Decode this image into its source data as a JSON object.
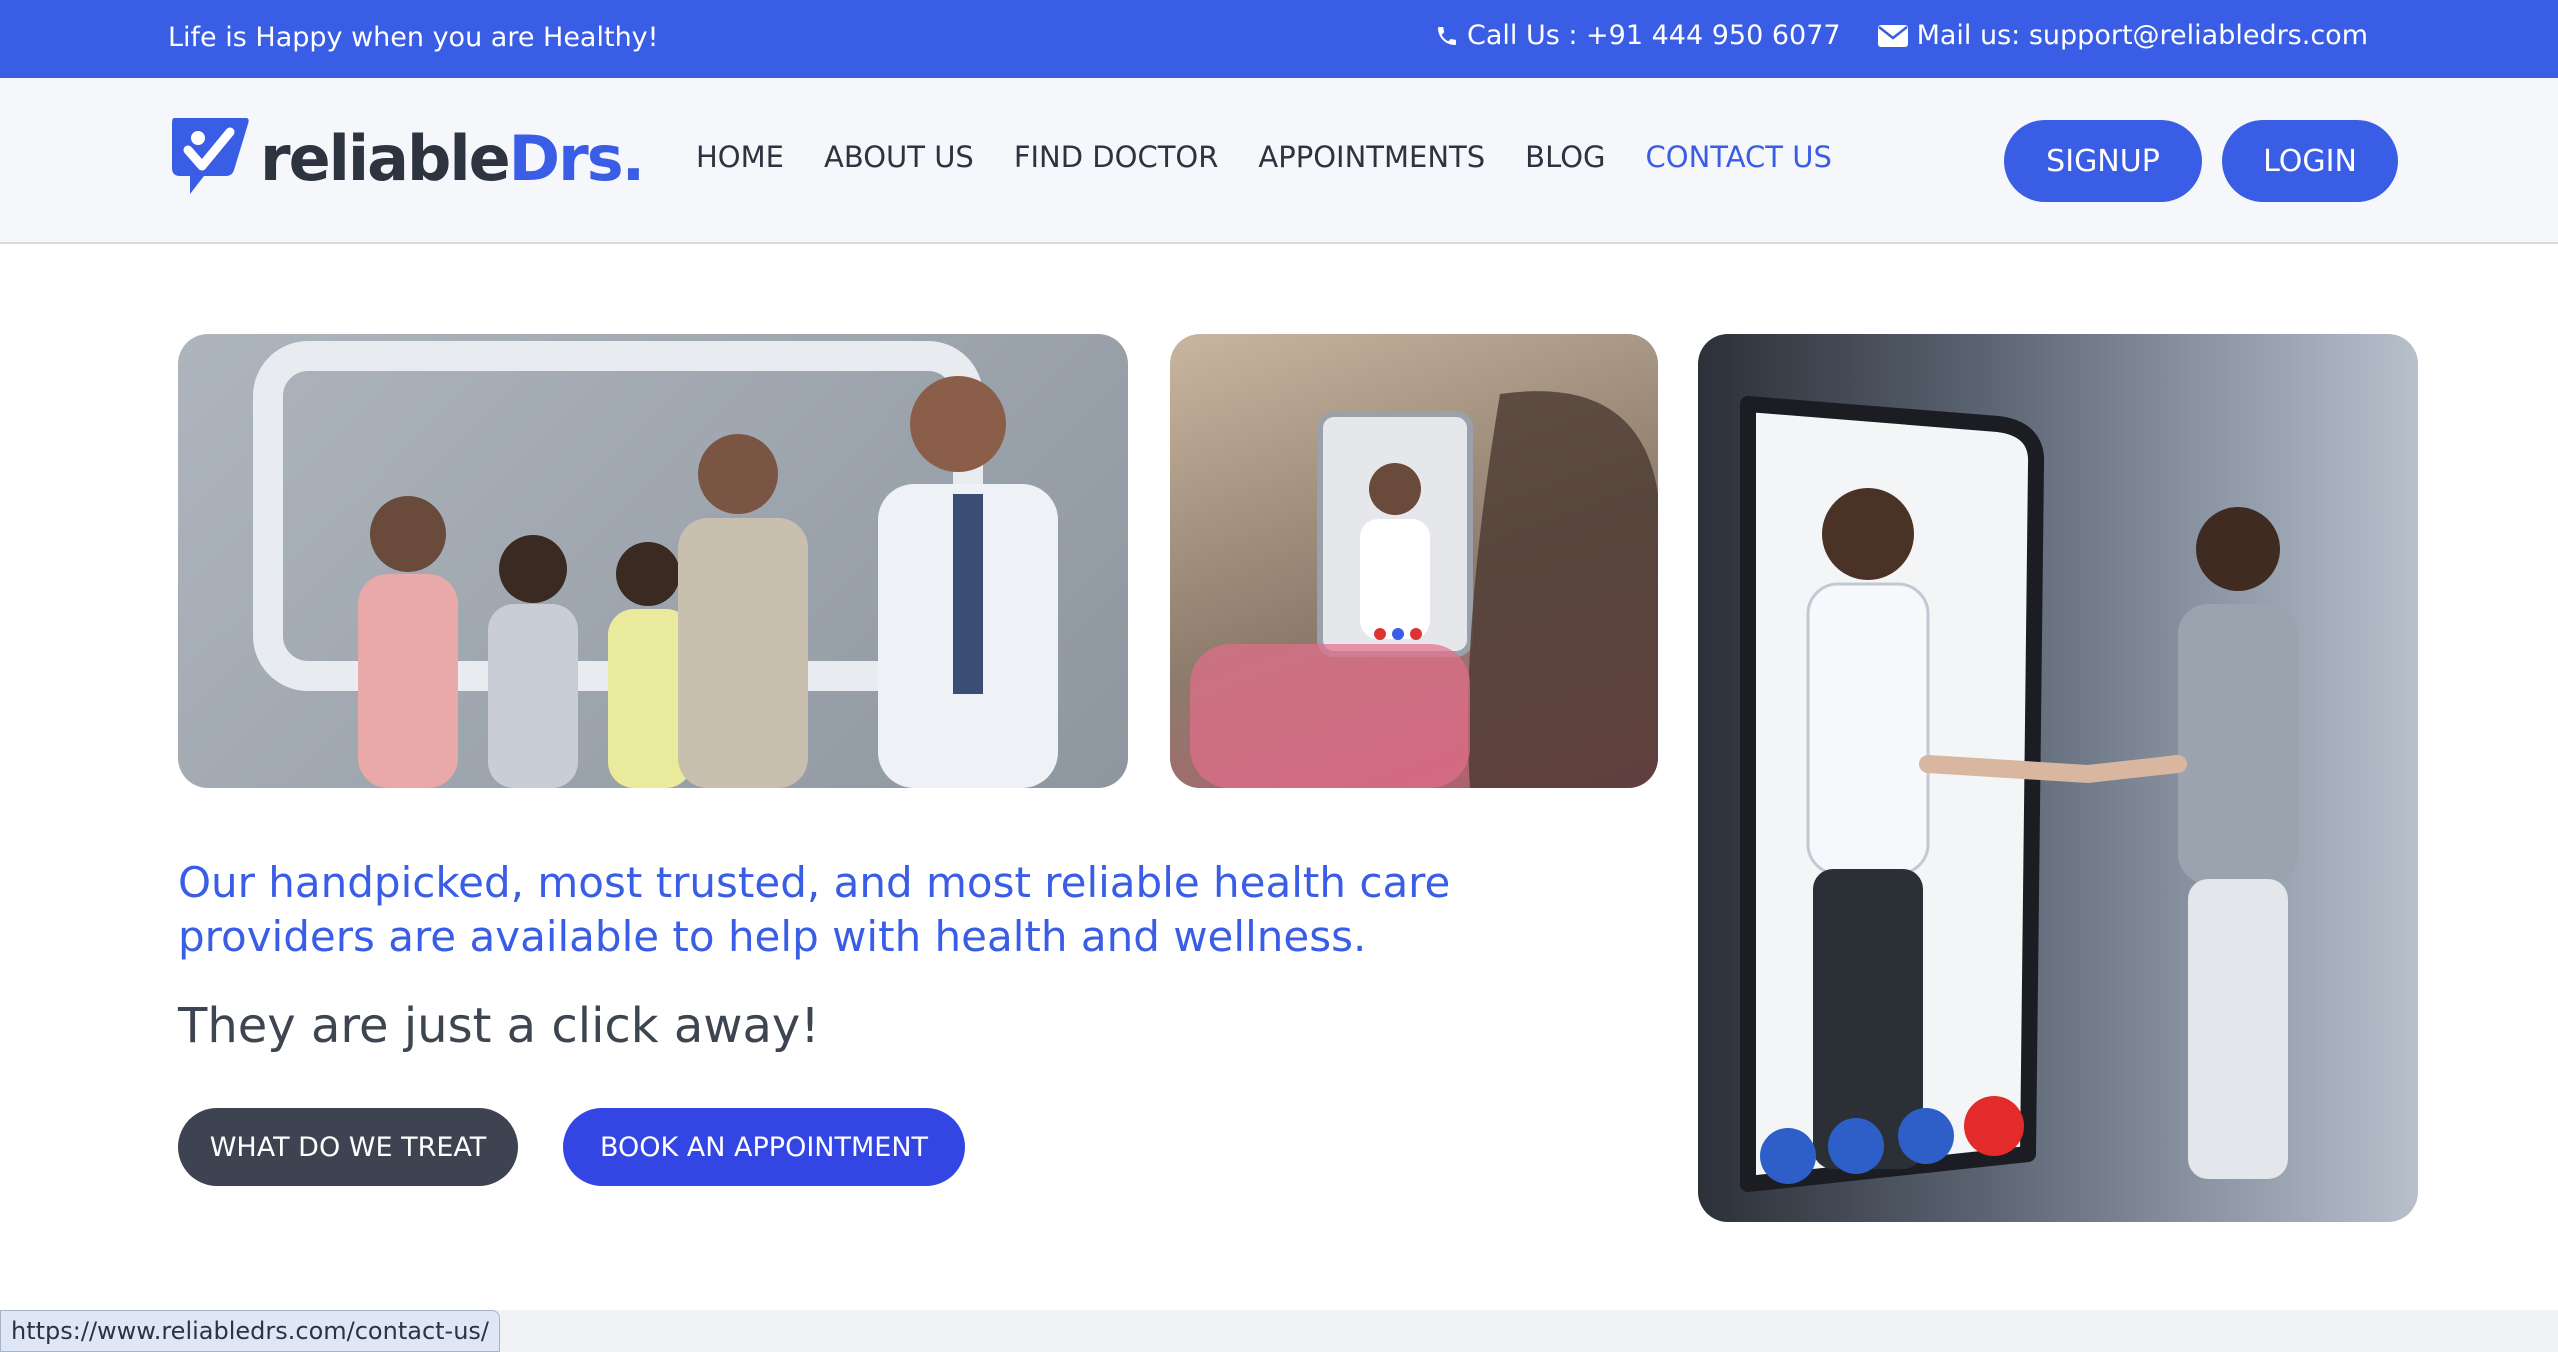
{
  "topbar": {
    "tagline": "Life is Happy when you are Healthy!",
    "phone": "Call Us : +91 444 950 6077",
    "mail": "Mail us: support@reliabledrs.com"
  },
  "logo": {
    "part1": "reliable",
    "part2": "Drs."
  },
  "nav": {
    "items": [
      "HOME",
      "ABOUT US",
      "FIND DOCTOR",
      "APPOINTMENTS",
      "BLOG",
      "CONTACT US"
    ],
    "active": "CONTACT US",
    "signup": "SIGNUP",
    "login": "LOGIN"
  },
  "hero": {
    "headline": "Our handpicked, most trusted, and most reliable health care providers are available to help with health and wellness.",
    "subline": "They are just a click away!",
    "btn_treat": "WHAT DO WE TREAT",
    "btn_book": "BOOK AN APPOINTMENT"
  },
  "status_url": "https://www.reliabledrs.com/contact-us/",
  "colors": {
    "brand": "#3a5de6",
    "dark": "#3d4350"
  }
}
